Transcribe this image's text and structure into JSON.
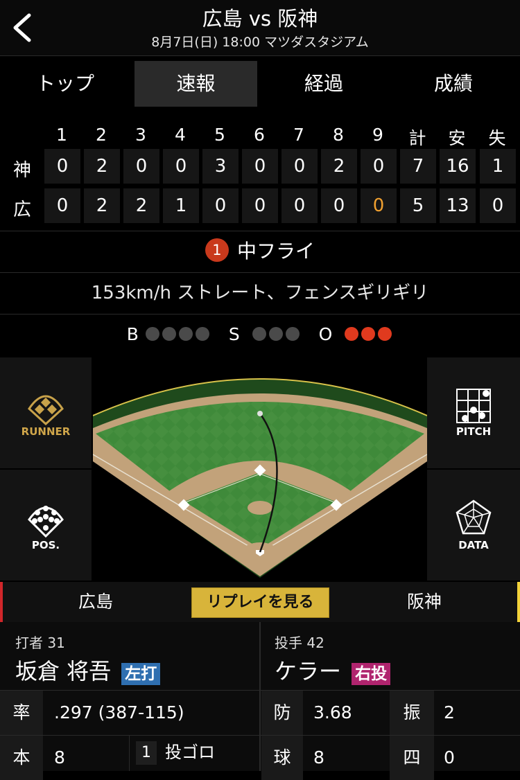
{
  "header": {
    "title": "広島 vs 阪神",
    "subtitle": "8月7日(日) 18:00 マツダスタジアム"
  },
  "tabs": [
    {
      "label": "トップ"
    },
    {
      "label": "速報"
    },
    {
      "label": "経過"
    },
    {
      "label": "成績"
    }
  ],
  "scoreboard": {
    "headers": [
      "1",
      "2",
      "3",
      "4",
      "5",
      "6",
      "7",
      "8",
      "9",
      "計",
      "安",
      "失"
    ],
    "teams": [
      {
        "name": "神",
        "scores": [
          "0",
          "2",
          "0",
          "0",
          "3",
          "0",
          "0",
          "2",
          "0",
          "7",
          "16",
          "1"
        ]
      },
      {
        "name": "広",
        "scores": [
          "0",
          "2",
          "2",
          "1",
          "0",
          "0",
          "0",
          "0",
          "0",
          "5",
          "13",
          "0"
        ]
      }
    ],
    "highlight_color": "#f0a030"
  },
  "play": {
    "out_number": "1",
    "result": "中フライ",
    "detail": "153km/h ストレート、フェンスギリギリ"
  },
  "count": {
    "b_label": "B",
    "s_label": "S",
    "o_label": "O",
    "balls": 0,
    "strikes": 0,
    "outs": 3
  },
  "side_buttons": {
    "runner": "RUNNER",
    "pitch": "PITCH",
    "pos": "POS.",
    "data": "DATA"
  },
  "team_bar": {
    "home": "広島",
    "away": "阪神",
    "replay": "リプレイを見る"
  },
  "batter": {
    "label": "打者 31",
    "name": "坂倉 将吾",
    "hand": "左打",
    "hand_color": "#2f6fb0",
    "rate_label": "率",
    "rate": ".297 (387-115)",
    "hr_label": "本",
    "hr": "8",
    "history_num": "1",
    "history": "投ゴロ"
  },
  "pitcher": {
    "label": "投手 42",
    "name": "ケラー",
    "hand": "右投",
    "hand_color": "#b0246e",
    "era_label": "防",
    "era": "3.68",
    "k_label": "振",
    "k": "2",
    "pitches_label": "球",
    "pitches": "8",
    "bb_label": "四",
    "bb": "0"
  }
}
